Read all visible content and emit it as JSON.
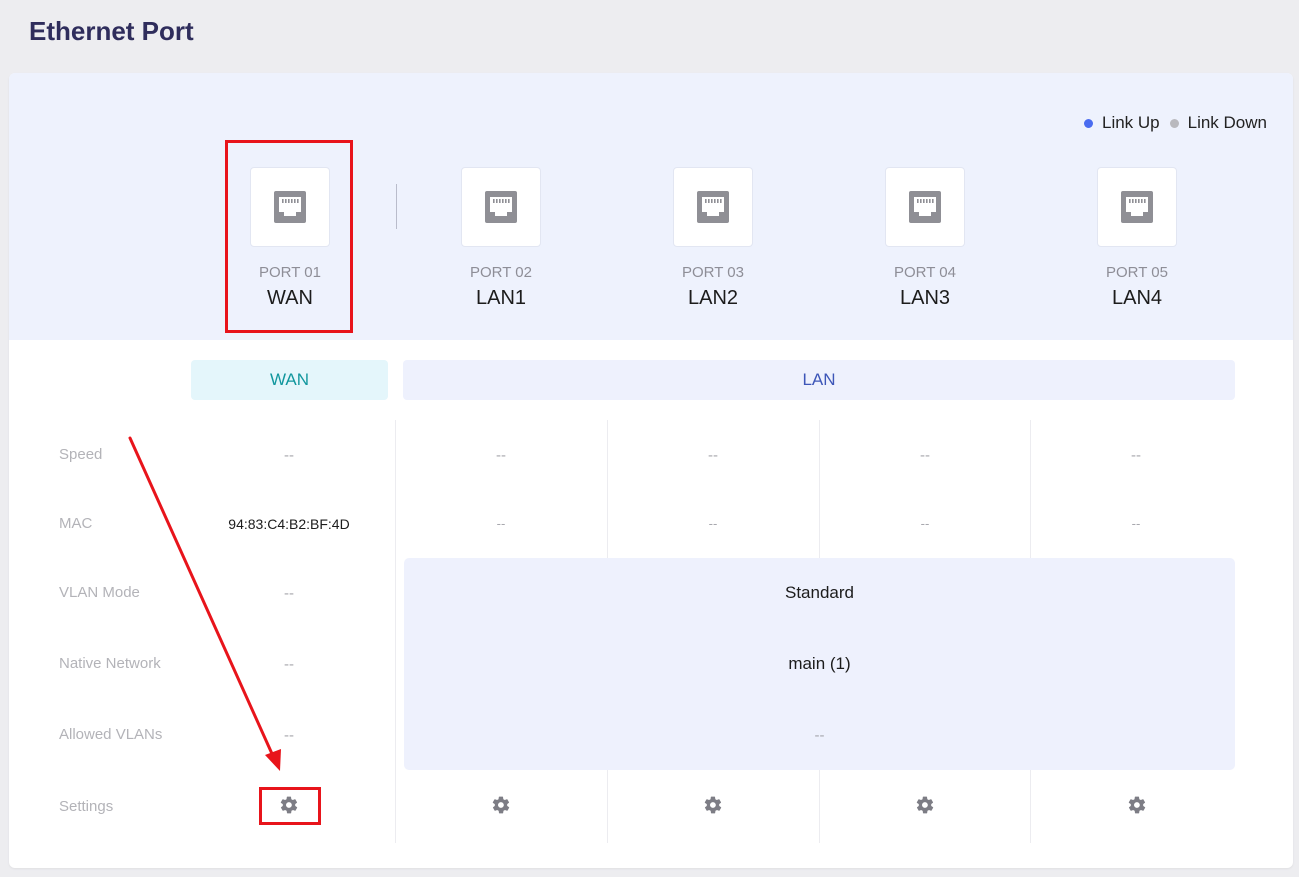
{
  "page": {
    "title": "Ethernet Port"
  },
  "legend": {
    "link_up": {
      "label": "Link Up",
      "color": "#4a6cf0"
    },
    "link_down": {
      "label": "Link Down",
      "color": "#b9b9be"
    }
  },
  "ports": [
    {
      "number": "PORT 01",
      "name": "WAN",
      "icon": "ethernet-port-icon"
    },
    {
      "number": "PORT 02",
      "name": "LAN1",
      "icon": "ethernet-port-icon"
    },
    {
      "number": "PORT 03",
      "name": "LAN2",
      "icon": "ethernet-port-icon"
    },
    {
      "number": "PORT 04",
      "name": "LAN3",
      "icon": "ethernet-port-icon"
    },
    {
      "number": "PORT 05",
      "name": "LAN4",
      "icon": "ethernet-port-icon"
    }
  ],
  "groups": {
    "wan": "WAN",
    "lan": "LAN"
  },
  "rows": {
    "speed": {
      "label": "Speed",
      "values": [
        "--",
        "--",
        "--",
        "--",
        "--"
      ]
    },
    "mac": {
      "label": "MAC",
      "values": [
        "94:83:C4:B2:BF:4D",
        "--",
        "--",
        "--",
        "--"
      ]
    },
    "vlan_mode": {
      "label": "VLAN Mode",
      "wan": "--",
      "lan": "Standard"
    },
    "native_network": {
      "label": "Native Network",
      "wan": "--",
      "lan": "main (1)"
    },
    "allowed_vlans": {
      "label": "Allowed VLANs",
      "wan": "--",
      "lan": "--"
    },
    "settings": {
      "label": "Settings",
      "icon": "gear-icon"
    }
  },
  "colors": {
    "accent": "#2f2d5c",
    "annotation": "#e8141b",
    "wan_group": "#12979e",
    "lan_group": "#3d56b8"
  }
}
